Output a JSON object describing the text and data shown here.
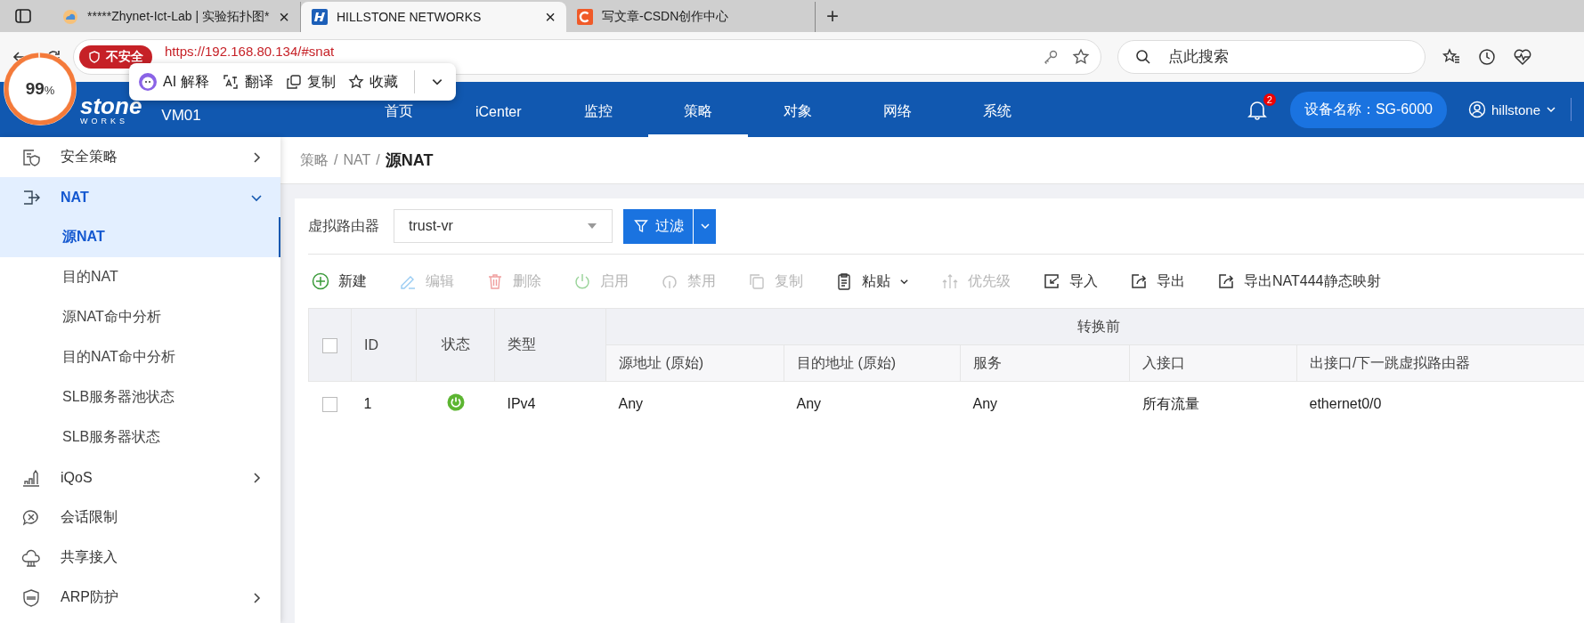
{
  "browser": {
    "tabs": [
      {
        "title": "*****Zhynet-Ict-Lab | 实验拓扑图*",
        "selected": false
      },
      {
        "title": "HILLSTONE NETWORKS",
        "selected": true
      },
      {
        "title": "写文章-CSDN创作中心",
        "selected": false
      }
    ],
    "tab_close": "×",
    "new_tab": "+",
    "security": "不安全",
    "url": "https://192.168.80.134/#snat",
    "search": {
      "placeholder": "点此搜索"
    }
  },
  "percent_widget": {
    "value": "99",
    "unit": "%",
    "level": 0.99
  },
  "selection_popup": {
    "items": [
      "AI 解释",
      "翻译",
      "复制",
      "收藏"
    ]
  },
  "header": {
    "logo": "stone",
    "logo_sub": "WORKS",
    "device": "VM01",
    "nav": [
      {
        "label": "首页",
        "selected": false
      },
      {
        "label": "iCenter",
        "selected": false
      },
      {
        "label": "监控",
        "selected": false
      },
      {
        "label": "策略",
        "selected": true
      },
      {
        "label": "对象",
        "selected": false
      },
      {
        "label": "网络",
        "selected": false
      },
      {
        "label": "系统",
        "selected": false
      }
    ],
    "notifications": "2",
    "device_name": "设备名称：SG-6000",
    "user": "hillstone"
  },
  "sidebar": [
    {
      "label": "安全策略",
      "expandable": true,
      "expanded": false,
      "selected": false
    },
    {
      "label": "NAT",
      "expandable": true,
      "expanded": true,
      "selected": true,
      "children": [
        {
          "label": "源NAT",
          "selected": true
        },
        {
          "label": "目的NAT",
          "selected": false
        },
        {
          "label": "源NAT命中分析",
          "selected": false
        },
        {
          "label": "目的NAT命中分析",
          "selected": false
        },
        {
          "label": "SLB服务器池状态",
          "selected": false
        },
        {
          "label": "SLB服务器状态",
          "selected": false
        }
      ]
    },
    {
      "label": "iQoS",
      "expandable": true,
      "expanded": false,
      "selected": false
    },
    {
      "label": "会话限制",
      "expandable": false,
      "selected": false
    },
    {
      "label": "共享接入",
      "expandable": false,
      "selected": false
    },
    {
      "label": "ARP防护",
      "expandable": true,
      "expanded": false,
      "selected": false
    }
  ],
  "breadcrumb": {
    "items": [
      "策略",
      "NAT",
      "源NAT"
    ],
    "separator": "/"
  },
  "filter": {
    "label": "虚拟路由器",
    "value": "trust-vr",
    "button": "过滤"
  },
  "toolbar": [
    {
      "label": "新建",
      "disabled": false,
      "dropdown": false
    },
    {
      "label": "编辑",
      "disabled": true,
      "dropdown": false
    },
    {
      "label": "删除",
      "disabled": true,
      "dropdown": false
    },
    {
      "label": "启用",
      "disabled": true,
      "dropdown": false
    },
    {
      "label": "禁用",
      "disabled": true,
      "dropdown": false
    },
    {
      "label": "复制",
      "disabled": true,
      "dropdown": false
    },
    {
      "label": "粘贴",
      "disabled": false,
      "dropdown": true
    },
    {
      "label": "优先级",
      "disabled": true,
      "dropdown": false
    },
    {
      "label": "导入",
      "disabled": false,
      "dropdown": false
    },
    {
      "label": "导出",
      "disabled": false,
      "dropdown": false
    },
    {
      "label": "导出NAT444静态映射",
      "disabled": false,
      "dropdown": false
    }
  ],
  "table": {
    "select_all_checked": false,
    "lead_columns": [
      "ID",
      "状态",
      "类型"
    ],
    "group": "转换前",
    "columns": [
      "源地址 (原始)",
      "目的地址 (原始)",
      "服务",
      "入接口",
      "出接口/下一跳虚拟路由器"
    ],
    "rows": [
      {
        "checked": false,
        "id": "1",
        "enabled": true,
        "type": "IPv4",
        "cells": [
          "Any",
          "Any",
          "Any",
          "所有流量",
          "ethernet0/0"
        ]
      }
    ]
  }
}
